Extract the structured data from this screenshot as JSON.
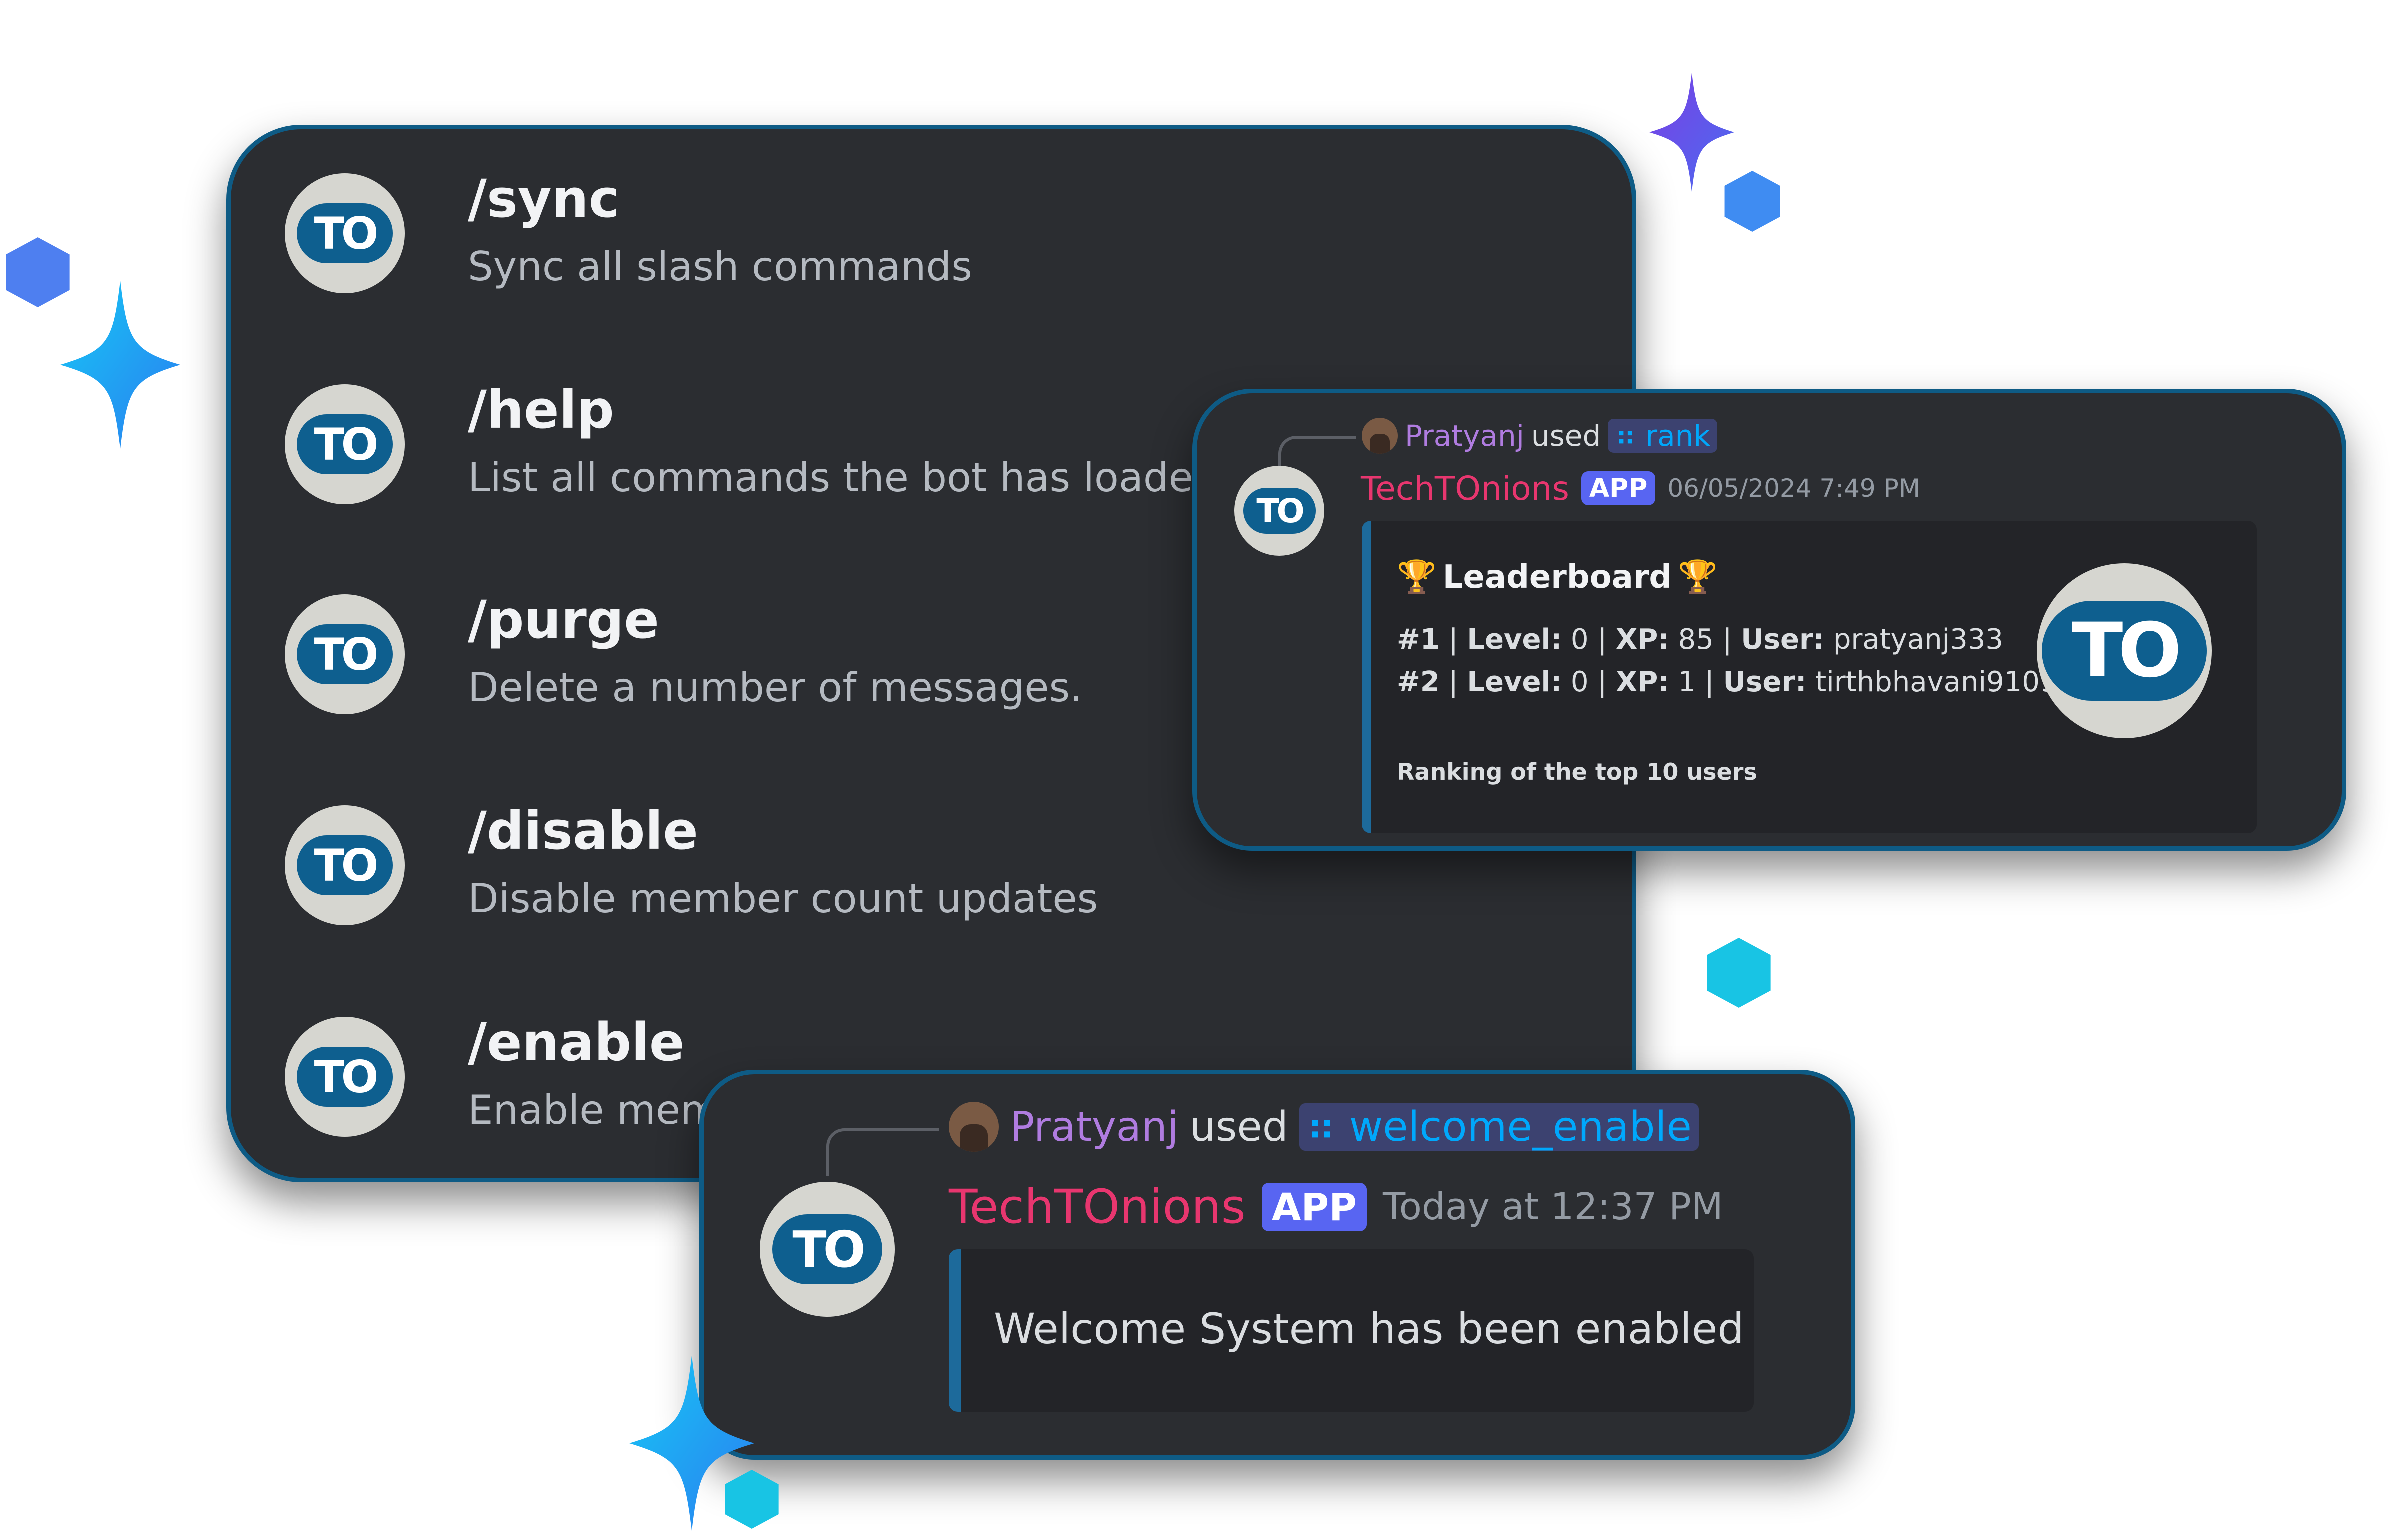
{
  "commands": [
    {
      "name": "/sync",
      "description": "Sync all slash commands"
    },
    {
      "name": "/help",
      "description": "List all commands the bot has loaded."
    },
    {
      "name": "/purge",
      "description": "Delete a number of messages."
    },
    {
      "name": "/disable",
      "description": "Disable member count updates"
    },
    {
      "name": "/enable",
      "description": "Enable mem"
    }
  ],
  "avatar_text": "TO",
  "leaderboard_message": {
    "invoker": "Pratyanj",
    "used_text": "used",
    "command": "rank",
    "bot_name": "TechTOnions",
    "badge": "APP",
    "timestamp": "06/05/2024 7:49 PM",
    "embed": {
      "title": "Leaderboard",
      "rows": [
        {
          "rank": "#1",
          "level_label": "Level:",
          "level": "0",
          "xp_label": "XP:",
          "xp": "85",
          "user_label": "User:",
          "user": "pratyanj333"
        },
        {
          "rank": "#2",
          "level_label": "Level:",
          "level": "0",
          "xp_label": "XP:",
          "xp": "1",
          "user_label": "User:",
          "user": "tirthbhavani9109"
        }
      ],
      "footer": "Ranking of the top 10 users"
    }
  },
  "welcome_message": {
    "invoker": "Pratyanj",
    "used_text": "used",
    "command": "welcome_enable",
    "bot_name": "TechTOnions",
    "badge": "APP",
    "timestamp": "Today at 12:37 PM",
    "embed_text": "Welcome System has been enabled"
  },
  "colors": {
    "panel_bg": "#2b2d31",
    "panel_border": "#0e5b85",
    "bot_name": "#e8366f",
    "invoker_name": "#b07ce0",
    "command_chip_text": "#00a8fc",
    "app_badge": "#5865f2",
    "embed_accent": "#1d6a9b"
  },
  "icons": [
    "slash-command-icon",
    "trophy-icon",
    "sparkle-star-icon",
    "hexagon-icon"
  ]
}
